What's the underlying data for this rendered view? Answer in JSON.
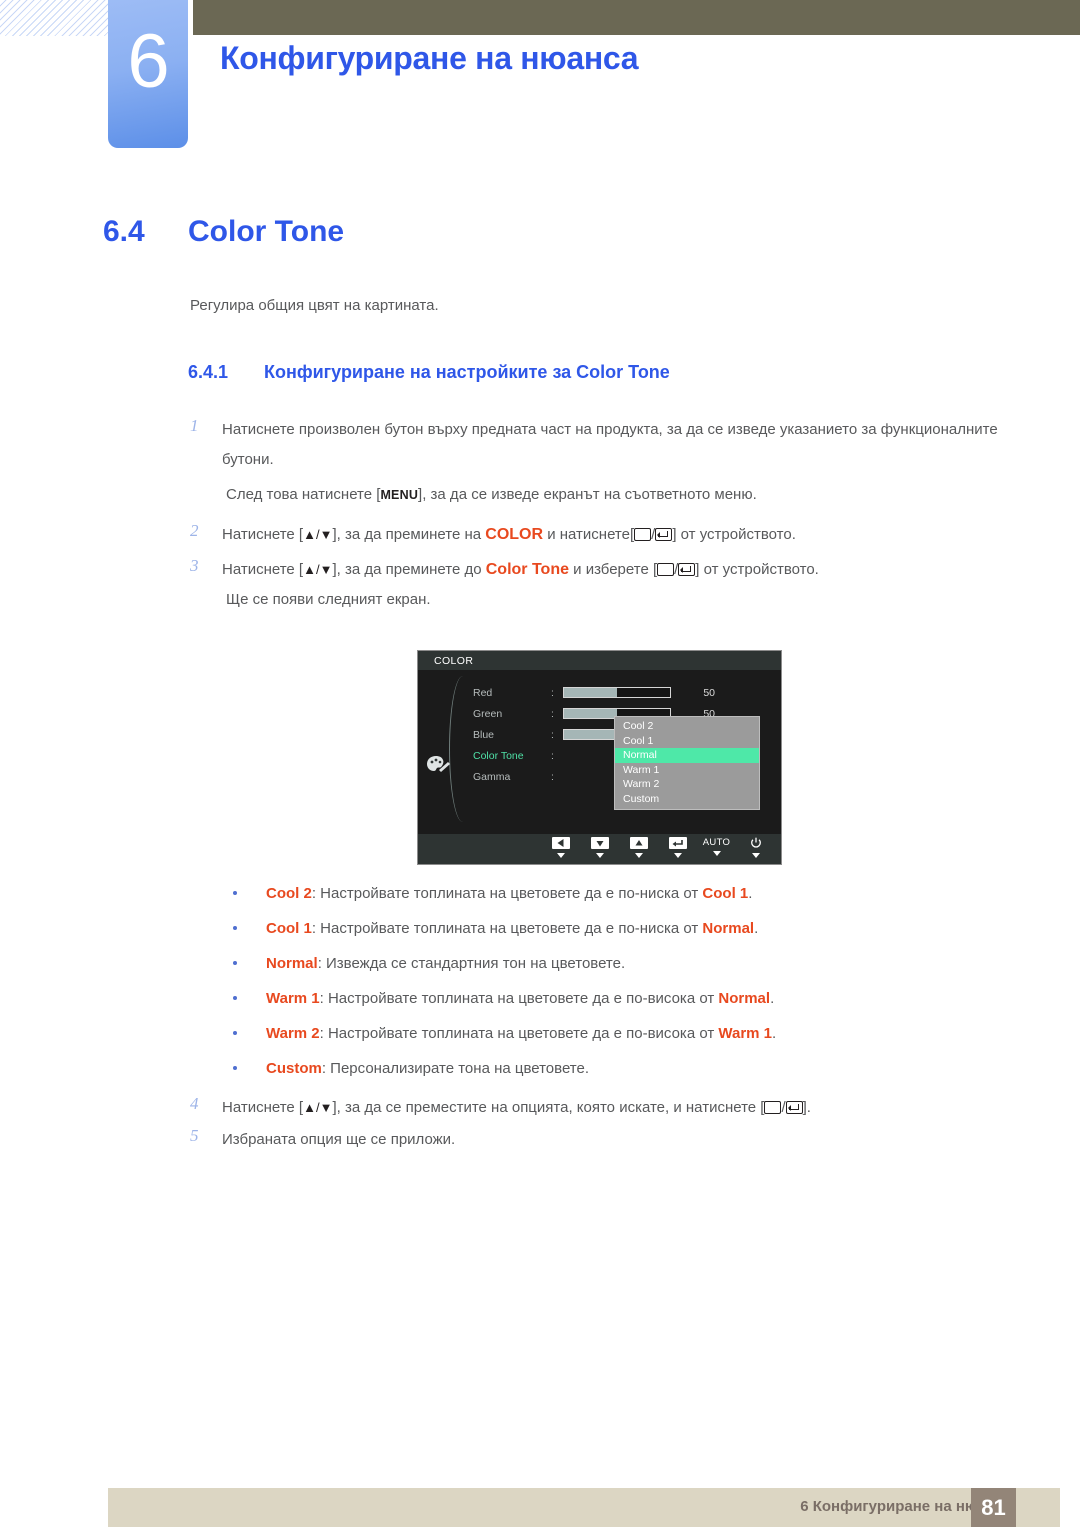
{
  "header": {
    "chapter_number": "6",
    "chapter_title": "Конфигуриране на нюанса"
  },
  "section": {
    "number": "6.4",
    "title": "Color Tone",
    "intro": "Регулира общия цвят на картината.",
    "subsection_number": "6.4.1",
    "subsection_title": "Конфигуриране на настройките за Color Tone"
  },
  "steps": {
    "s1_num": "1",
    "s1_text": "Натиснете произволен бутон върху предната част на продукта, за да се изведе указанието за функционалните бутони.",
    "s1_cont_pre": "След това натиснете [",
    "s1_cont_key": "MENU",
    "s1_cont_post": "], за да се изведе екранът на съответното меню.",
    "s2_num": "2",
    "s2_a": "Натиснете [",
    "s2_arrows": "▲/▼",
    "s2_b": "], за да преминете на ",
    "s2_kw": "COLOR",
    "s2_c": " и натиснете[",
    "s2_d": "/",
    "s2_e": "] от устройството.",
    "s3_num": "3",
    "s3_a": "Натиснете [",
    "s3_arrows": "▲/▼",
    "s3_b": "], за да преминете до ",
    "s3_kw": "Color Tone",
    "s3_c": " и изберете [",
    "s3_d": "/",
    "s3_e": "] от устройството.",
    "s3_cont": "Ще се появи следният екран.",
    "s4_num": "4",
    "s4_a": "Натиснете [",
    "s4_arrows": "▲/▼",
    "s4_b": "], за да се преместите на опцията, която искате, и натиснете [",
    "s4_d": "/",
    "s4_e": "].",
    "s5_num": "5",
    "s5_text": "Избраната опция ще се приложи."
  },
  "osd": {
    "title": "COLOR",
    "icon": "palette-icon",
    "rows": [
      {
        "label": "Red",
        "colon": ":",
        "value": "50",
        "fill_percent": 50
      },
      {
        "label": "Green",
        "colon": ":",
        "value": "50",
        "fill_percent": 50
      },
      {
        "label": "Blue",
        "colon": ":",
        "value": "50",
        "fill_percent": 50
      },
      {
        "label": "Color Tone",
        "colon": ":",
        "value": "",
        "fill_percent": 0
      },
      {
        "label": "Gamma",
        "colon": ":",
        "value": "",
        "fill_percent": 0
      }
    ],
    "selected_row": "Color Tone",
    "dropdown_options": [
      "Cool 2",
      "Cool 1",
      "Normal",
      "Warm 1",
      "Warm 2",
      "Custom"
    ],
    "dropdown_active": "Normal",
    "footer_buttons": [
      {
        "name": "left-arrow-button",
        "label": ""
      },
      {
        "name": "down-arrow-button",
        "label": ""
      },
      {
        "name": "up-arrow-button",
        "label": ""
      },
      {
        "name": "enter-button",
        "label": ""
      },
      {
        "name": "auto-button",
        "label": "AUTO"
      },
      {
        "name": "power-button",
        "label": ""
      }
    ],
    "colors": {
      "background": "#1b1b1b",
      "title_bar": "#2e3433",
      "selected_text": "#4fe0a6",
      "highlight": "#4ee8a8",
      "dropdown_bg": "#9b9b9b",
      "slider_fill": "#a5b6b6"
    }
  },
  "bullets": [
    {
      "term": "Cool 2",
      "before": ": Настройвате топлината на цветовете да е по-ниска от ",
      "ref": "Cool 1",
      "after": "."
    },
    {
      "term": "Cool 1",
      "before": ": Настройвате топлината на цветовете да е по-ниска от ",
      "ref": "Normal",
      "after": "."
    },
    {
      "term": "Normal",
      "before": ": Извежда се стандартния тон на цветовете.",
      "ref": "",
      "after": ""
    },
    {
      "term": "Warm 1",
      "before": ": Настройвате топлината на цветовете да е по-висока от ",
      "ref": "Normal",
      "after": "."
    },
    {
      "term": "Warm 2",
      "before": ": Настройвате топлината на цветовете да е по-висока от ",
      "ref": "Warm 1",
      "after": "."
    },
    {
      "term": "Custom",
      "before": ": Персонализирате тона на цветовете.",
      "ref": "",
      "after": ""
    }
  ],
  "footer": {
    "label": "6 Конфигуриране на нюанса",
    "page": "81"
  },
  "colors": {
    "accent_blue": "#2f57e8",
    "keyword_orange": "#e8491f",
    "body_gray": "#58595b",
    "olive": "#6b6854",
    "footer_beige": "#dcd6c3",
    "footer_badge": "#938578"
  }
}
